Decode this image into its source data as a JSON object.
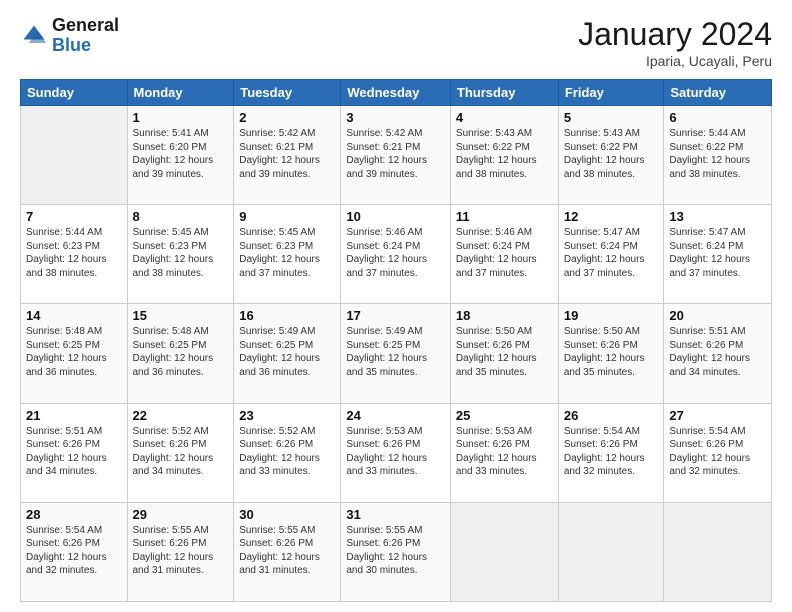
{
  "header": {
    "logo_general": "General",
    "logo_blue": "Blue",
    "month_year": "January 2024",
    "location": "Iparia, Ucayali, Peru"
  },
  "days_of_week": [
    "Sunday",
    "Monday",
    "Tuesday",
    "Wednesday",
    "Thursday",
    "Friday",
    "Saturday"
  ],
  "weeks": [
    [
      {
        "day": "",
        "sunrise": "",
        "sunset": "",
        "daylight": ""
      },
      {
        "day": "1",
        "sunrise": "5:41 AM",
        "sunset": "6:20 PM",
        "daylight": "12 hours and 39 minutes."
      },
      {
        "day": "2",
        "sunrise": "5:42 AM",
        "sunset": "6:21 PM",
        "daylight": "12 hours and 39 minutes."
      },
      {
        "day": "3",
        "sunrise": "5:42 AM",
        "sunset": "6:21 PM",
        "daylight": "12 hours and 39 minutes."
      },
      {
        "day": "4",
        "sunrise": "5:43 AM",
        "sunset": "6:22 PM",
        "daylight": "12 hours and 38 minutes."
      },
      {
        "day": "5",
        "sunrise": "5:43 AM",
        "sunset": "6:22 PM",
        "daylight": "12 hours and 38 minutes."
      },
      {
        "day": "6",
        "sunrise": "5:44 AM",
        "sunset": "6:22 PM",
        "daylight": "12 hours and 38 minutes."
      }
    ],
    [
      {
        "day": "7",
        "sunrise": "5:44 AM",
        "sunset": "6:23 PM",
        "daylight": "12 hours and 38 minutes."
      },
      {
        "day": "8",
        "sunrise": "5:45 AM",
        "sunset": "6:23 PM",
        "daylight": "12 hours and 38 minutes."
      },
      {
        "day": "9",
        "sunrise": "5:45 AM",
        "sunset": "6:23 PM",
        "daylight": "12 hours and 37 minutes."
      },
      {
        "day": "10",
        "sunrise": "5:46 AM",
        "sunset": "6:24 PM",
        "daylight": "12 hours and 37 minutes."
      },
      {
        "day": "11",
        "sunrise": "5:46 AM",
        "sunset": "6:24 PM",
        "daylight": "12 hours and 37 minutes."
      },
      {
        "day": "12",
        "sunrise": "5:47 AM",
        "sunset": "6:24 PM",
        "daylight": "12 hours and 37 minutes."
      },
      {
        "day": "13",
        "sunrise": "5:47 AM",
        "sunset": "6:24 PM",
        "daylight": "12 hours and 37 minutes."
      }
    ],
    [
      {
        "day": "14",
        "sunrise": "5:48 AM",
        "sunset": "6:25 PM",
        "daylight": "12 hours and 36 minutes."
      },
      {
        "day": "15",
        "sunrise": "5:48 AM",
        "sunset": "6:25 PM",
        "daylight": "12 hours and 36 minutes."
      },
      {
        "day": "16",
        "sunrise": "5:49 AM",
        "sunset": "6:25 PM",
        "daylight": "12 hours and 36 minutes."
      },
      {
        "day": "17",
        "sunrise": "5:49 AM",
        "sunset": "6:25 PM",
        "daylight": "12 hours and 35 minutes."
      },
      {
        "day": "18",
        "sunrise": "5:50 AM",
        "sunset": "6:26 PM",
        "daylight": "12 hours and 35 minutes."
      },
      {
        "day": "19",
        "sunrise": "5:50 AM",
        "sunset": "6:26 PM",
        "daylight": "12 hours and 35 minutes."
      },
      {
        "day": "20",
        "sunrise": "5:51 AM",
        "sunset": "6:26 PM",
        "daylight": "12 hours and 34 minutes."
      }
    ],
    [
      {
        "day": "21",
        "sunrise": "5:51 AM",
        "sunset": "6:26 PM",
        "daylight": "12 hours and 34 minutes."
      },
      {
        "day": "22",
        "sunrise": "5:52 AM",
        "sunset": "6:26 PM",
        "daylight": "12 hours and 34 minutes."
      },
      {
        "day": "23",
        "sunrise": "5:52 AM",
        "sunset": "6:26 PM",
        "daylight": "12 hours and 33 minutes."
      },
      {
        "day": "24",
        "sunrise": "5:53 AM",
        "sunset": "6:26 PM",
        "daylight": "12 hours and 33 minutes."
      },
      {
        "day": "25",
        "sunrise": "5:53 AM",
        "sunset": "6:26 PM",
        "daylight": "12 hours and 33 minutes."
      },
      {
        "day": "26",
        "sunrise": "5:54 AM",
        "sunset": "6:26 PM",
        "daylight": "12 hours and 32 minutes."
      },
      {
        "day": "27",
        "sunrise": "5:54 AM",
        "sunset": "6:26 PM",
        "daylight": "12 hours and 32 minutes."
      }
    ],
    [
      {
        "day": "28",
        "sunrise": "5:54 AM",
        "sunset": "6:26 PM",
        "daylight": "12 hours and 32 minutes."
      },
      {
        "day": "29",
        "sunrise": "5:55 AM",
        "sunset": "6:26 PM",
        "daylight": "12 hours and 31 minutes."
      },
      {
        "day": "30",
        "sunrise": "5:55 AM",
        "sunset": "6:26 PM",
        "daylight": "12 hours and 31 minutes."
      },
      {
        "day": "31",
        "sunrise": "5:55 AM",
        "sunset": "6:26 PM",
        "daylight": "12 hours and 30 minutes."
      },
      {
        "day": "",
        "sunrise": "",
        "sunset": "",
        "daylight": ""
      },
      {
        "day": "",
        "sunrise": "",
        "sunset": "",
        "daylight": ""
      },
      {
        "day": "",
        "sunrise": "",
        "sunset": "",
        "daylight": ""
      }
    ]
  ],
  "labels": {
    "sunrise_prefix": "Sunrise: ",
    "sunset_prefix": "Sunset: ",
    "daylight_prefix": "Daylight: "
  }
}
